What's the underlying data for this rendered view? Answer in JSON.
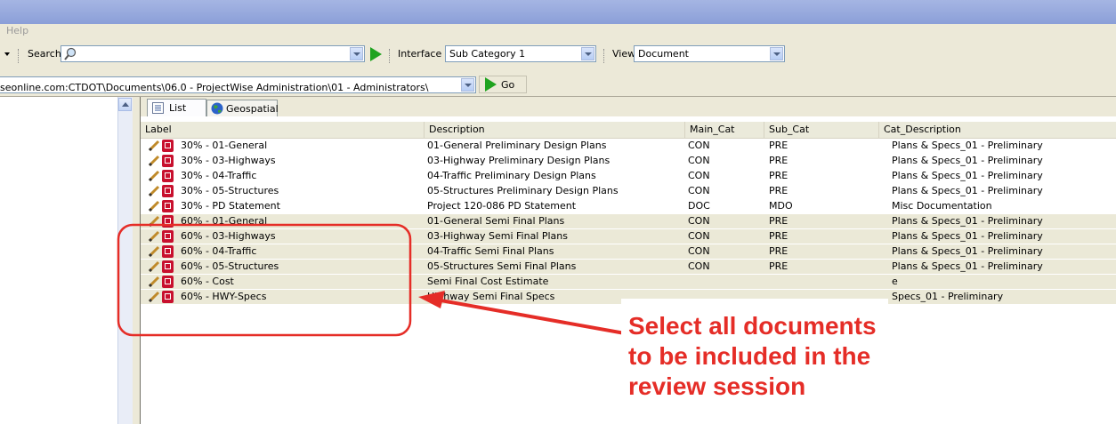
{
  "menu": {
    "help": "Help"
  },
  "toolbar": {
    "search_label": "Search",
    "interface_label": "Interface",
    "interface_value": "Sub Category 1",
    "view_label": "View",
    "view_value": "Document"
  },
  "path": {
    "value": "seonline.com:CTDOT\\Documents\\06.0 - ProjectWise Administration\\01 - Administrators\\",
    "go_label": "Go"
  },
  "tabs": [
    {
      "label": "List",
      "icon": "list-icon"
    },
    {
      "label": "Geospatial",
      "icon": "globe-icon"
    }
  ],
  "columns": [
    "Label",
    "Description",
    "Main_Cat",
    "Sub_Cat",
    "Cat_Description"
  ],
  "rows": [
    {
      "label": "30% - 01-General",
      "description": "01-General Preliminary Design Plans",
      "main_cat": "CON",
      "sub_cat": "PRE",
      "cat_description": "Plans & Specs_01 - Preliminary"
    },
    {
      "label": "30% - 03-Highways",
      "description": "03-Highway Preliminary Design Plans",
      "main_cat": "CON",
      "sub_cat": "PRE",
      "cat_description": "Plans & Specs_01 - Preliminary"
    },
    {
      "label": "30% - 04-Traffic",
      "description": "04-Traffic Preliminary Design Plans",
      "main_cat": "CON",
      "sub_cat": "PRE",
      "cat_description": "Plans & Specs_01 - Preliminary"
    },
    {
      "label": "30% - 05-Structures",
      "description": "05-Structures Preliminary Design Plans",
      "main_cat": "CON",
      "sub_cat": "PRE",
      "cat_description": "Plans & Specs_01 - Preliminary"
    },
    {
      "label": "30% - PD Statement",
      "description": "Project 120-086 PD Statement",
      "main_cat": "DOC",
      "sub_cat": "MDO",
      "cat_description": "Misc Documentation"
    },
    {
      "label": "60% - 01-General",
      "description": "01-General Semi Final Plans",
      "main_cat": "CON",
      "sub_cat": "PRE",
      "cat_description": "Plans & Specs_01 - Preliminary"
    },
    {
      "label": "60% - 03-Highways",
      "description": "03-Highway Semi Final Plans",
      "main_cat": "CON",
      "sub_cat": "PRE",
      "cat_description": "Plans & Specs_01 - Preliminary"
    },
    {
      "label": "60% - 04-Traffic",
      "description": "04-Traffic Semi Final Plans",
      "main_cat": "CON",
      "sub_cat": "PRE",
      "cat_description": "Plans & Specs_01 - Preliminary"
    },
    {
      "label": "60% - 05-Structures",
      "description": "05-Structures Semi Final Plans",
      "main_cat": "CON",
      "sub_cat": "PRE",
      "cat_description": "Plans & Specs_01 - Preliminary"
    },
    {
      "label": "60% - Cost",
      "description": "Semi Final Cost Estimate",
      "main_cat": "",
      "sub_cat": "",
      "cat_description": "e"
    },
    {
      "label": "60% - HWY-Specs",
      "description": "Highway Semi Final Specs",
      "main_cat": "",
      "sub_cat": "",
      "cat_description": "Specs_01 - Preliminary"
    }
  ],
  "annotation": {
    "lines": [
      "Select all documents",
      "to be included in the",
      "review session"
    ],
    "color": "#e52d27"
  }
}
